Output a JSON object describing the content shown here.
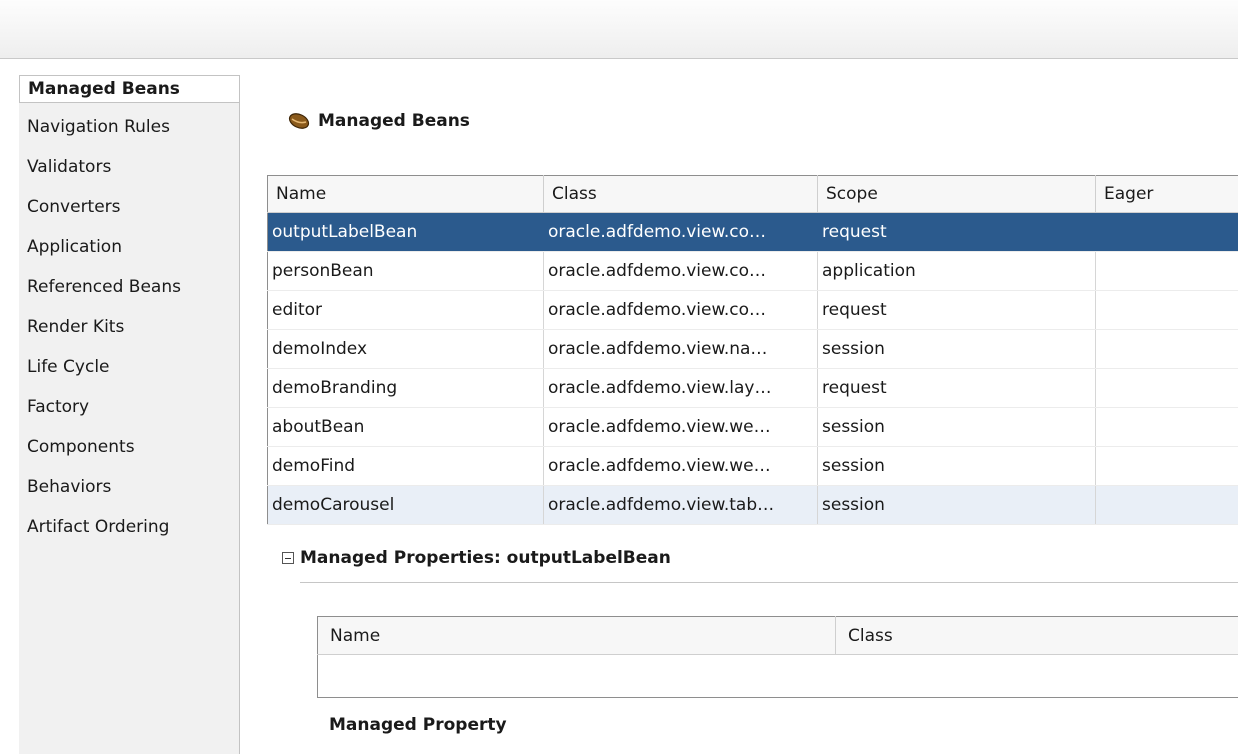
{
  "sidebar": {
    "items": [
      {
        "label": "Managed Beans",
        "active": true
      },
      {
        "label": "Navigation Rules"
      },
      {
        "label": "Validators"
      },
      {
        "label": "Converters"
      },
      {
        "label": "Application"
      },
      {
        "label": "Referenced Beans"
      },
      {
        "label": "Render Kits"
      },
      {
        "label": "Life Cycle"
      },
      {
        "label": "Factory"
      },
      {
        "label": "Components"
      },
      {
        "label": "Behaviors"
      },
      {
        "label": "Artifact Ordering"
      }
    ]
  },
  "main": {
    "title": "Managed Beans",
    "title_icon": "bean-icon",
    "beans_table": {
      "columns": [
        "Name",
        "Class",
        "Scope",
        "Eager"
      ],
      "rows": [
        {
          "name": "outputLabelBean",
          "class": "oracle.adfdemo.view.co…",
          "scope": "request",
          "eager": "",
          "selected": true
        },
        {
          "name": "personBean",
          "class": "oracle.adfdemo.view.co…",
          "scope": "application",
          "eager": ""
        },
        {
          "name": "editor",
          "class": "oracle.adfdemo.view.co…",
          "scope": "request",
          "eager": ""
        },
        {
          "name": "demoIndex",
          "class": "oracle.adfdemo.view.na…",
          "scope": "session",
          "eager": ""
        },
        {
          "name": "demoBranding",
          "class": "oracle.adfdemo.view.lay…",
          "scope": "request",
          "eager": ""
        },
        {
          "name": "aboutBean",
          "class": "oracle.adfdemo.view.we…",
          "scope": "session",
          "eager": ""
        },
        {
          "name": "demoFind",
          "class": "oracle.adfdemo.view.we…",
          "scope": "session",
          "eager": ""
        },
        {
          "name": "demoCarousel",
          "class": "oracle.adfdemo.view.tab…",
          "scope": "session",
          "eager": ""
        }
      ]
    },
    "properties": {
      "header": "Managed Properties: outputLabelBean",
      "columns": [
        "Name",
        "Class"
      ],
      "managed_property_label": "Managed Property"
    }
  },
  "colors": {
    "selection": "#2b5a8d",
    "focus_row": "#e9eff7",
    "sidebar_bg": "#f1f1f1"
  }
}
